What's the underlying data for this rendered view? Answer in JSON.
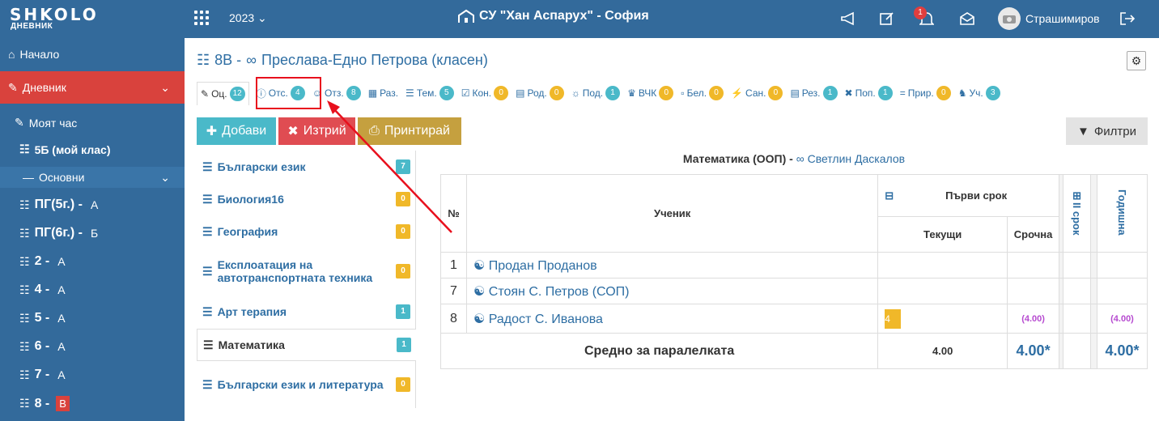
{
  "app": {
    "logo": "SHKOLO",
    "logo_sub": "ДНЕВНИК",
    "year": "2023",
    "school": "СУ \"Хан Аспарух\" - София",
    "notifications": "1",
    "user": "Страшимиров"
  },
  "sidebar": {
    "home": "Начало",
    "diary": "Дневник",
    "my_hour": "Моят час",
    "my_class": "5Б (мой клас)",
    "main": "Основни",
    "classes": [
      {
        "name": "ПГ(5г.) -",
        "letter": "А"
      },
      {
        "name": "ПГ(6г.) -",
        "letter": "Б"
      },
      {
        "name": "2 -",
        "letter": "А"
      },
      {
        "name": "4 -",
        "letter": "А"
      },
      {
        "name": "5 -",
        "letter": "А"
      },
      {
        "name": "6 -",
        "letter": "А"
      },
      {
        "name": "7 -",
        "letter": "А"
      },
      {
        "name": "8 -",
        "letter": "В"
      }
    ]
  },
  "page": {
    "class": "8В -",
    "teacher": "Преслава-Едно Петрова (класен)"
  },
  "tabs": [
    {
      "label": "Оц.",
      "count": "12"
    },
    {
      "label": "Отс.",
      "count": "4"
    },
    {
      "label": "Отз.",
      "count": "8"
    },
    {
      "label": "Раз.",
      "count": ""
    },
    {
      "label": "Тем.",
      "count": "5"
    },
    {
      "label": "Кон.",
      "count": "0"
    },
    {
      "label": "Род.",
      "count": "0"
    },
    {
      "label": "Под.",
      "count": "1"
    },
    {
      "label": "ВЧК",
      "count": "0"
    },
    {
      "label": "Бел.",
      "count": "0"
    },
    {
      "label": "Сан.",
      "count": "0"
    },
    {
      "label": "Рез.",
      "count": "1"
    },
    {
      "label": "Поп.",
      "count": "1"
    },
    {
      "label": "Прир.",
      "count": "0"
    },
    {
      "label": "Уч.",
      "count": "3"
    }
  ],
  "buttons": {
    "add": "Добави",
    "delete": "Изтрий",
    "print": "Принтирай",
    "filters": "Филтри"
  },
  "subjects": [
    {
      "name": "Български език",
      "count": "7"
    },
    {
      "name": "Биология16",
      "count": "0"
    },
    {
      "name": "География",
      "count": "0"
    },
    {
      "name": "Експлоатация на автотранспортната техника",
      "count": "0"
    },
    {
      "name": "Арт терапия",
      "count": "1"
    },
    {
      "name": "Математика",
      "count": "1"
    },
    {
      "name": "Български език и литература",
      "count": "0"
    }
  ],
  "grades": {
    "subject": "Математика (ООП) -",
    "teacher": "Светлин Даскалов",
    "col_no": "№",
    "col_student": "Ученик",
    "term1": "Първи срок",
    "current": "Текущи",
    "term_grade": "Срочна",
    "term2": "II срок",
    "annual": "Годишна",
    "rows": [
      {
        "no": "1",
        "name": "Продан Проданов",
        "current": "",
        "term": "",
        "annual": ""
      },
      {
        "no": "7",
        "name": "Стоян С. Петров (СОП)",
        "current": "",
        "term": "",
        "annual": ""
      },
      {
        "no": "8",
        "name": "Радост С. Иванова",
        "current": "4",
        "term": "(4.00)",
        "annual": "(4.00)"
      }
    ],
    "avg_label": "Средно за паралелката",
    "avg_current": "4.00",
    "avg_term": "4.00*",
    "avg_annual": "4.00*"
  }
}
